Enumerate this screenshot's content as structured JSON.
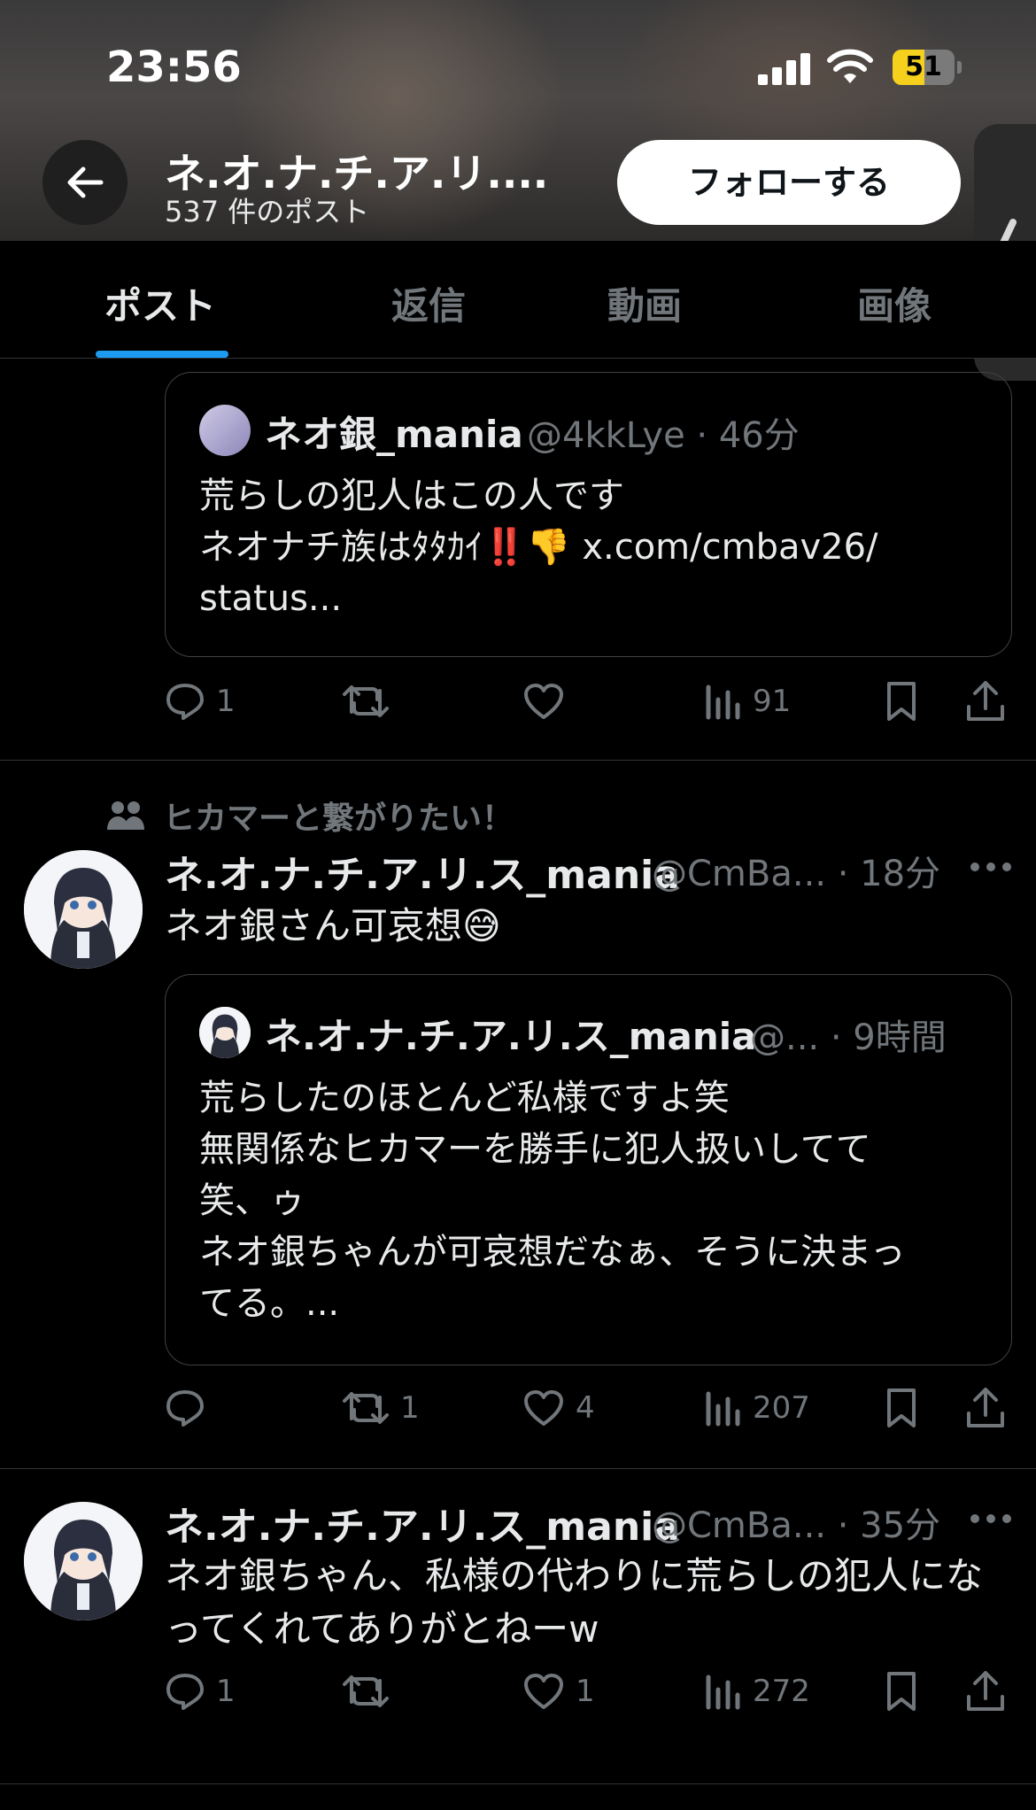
{
  "status_bar": {
    "time": "23:56",
    "battery": "51",
    "battery_level": 0.51
  },
  "profile_header": {
    "name": "ネ.オ.ナ.チ.ア.リ....",
    "post_count": "537 件のポスト",
    "follow_label": "フォローする"
  },
  "tabs": [
    {
      "label": "ポスト",
      "active": true
    },
    {
      "label": "返信",
      "active": false
    },
    {
      "label": "動画",
      "active": false
    },
    {
      "label": "画像",
      "active": false
    }
  ],
  "post1": {
    "quote": {
      "name": "ネオ銀_mania",
      "meta": "@4kkLye · 46分",
      "text": "荒らしの犯人はこの人です\nネオナチ族はﾀﾀｶｲ‼️👎 x.com/cmbav26/\nstatus..."
    },
    "actions": {
      "reply": "1",
      "repost": "",
      "like": "",
      "views": "91"
    }
  },
  "post2": {
    "social_context": "ヒカマーと繋がりたい！",
    "name": "ネ.オ.ナ.チ.ア.リ.ス_mania",
    "meta": "@CmBa... · 18分",
    "text": "ネオ銀さん可哀想😅",
    "quote": {
      "name": "ネ.オ.ナ.チ.ア.リ.ス_mania",
      "meta": "@... · 9時間",
      "text": "荒らしたのほとんど私様ですよ笑\n無関係なヒカマーを勝手に犯人扱いしてて\n笑、ゥ\nネオ銀ちゃんが可哀想だなぁ、そうに決まっ\nてる。..."
    },
    "actions": {
      "reply": "",
      "repost": "1",
      "like": "4",
      "views": "207"
    }
  },
  "post3": {
    "name": "ネ.オ.ナ.チ.ア.リ.ス_mania",
    "meta": "@CmBa... · 35分",
    "text": "ネオ銀ちゃん、私様の代わりに荒らしの犯人にな\nってくれてありがとねーw",
    "actions": {
      "reply": "1",
      "repost": "",
      "like": "1",
      "views": "272"
    }
  },
  "colors": {
    "accent": "#1d9bf0",
    "muted": "#71767b",
    "battery": "#f5d01d"
  }
}
